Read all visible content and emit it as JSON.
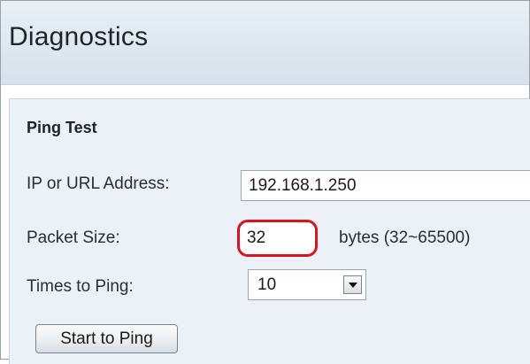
{
  "page": {
    "title": "Diagnostics"
  },
  "ping_test": {
    "section_title": "Ping Test",
    "ip_label": "IP or URL Address:",
    "ip_value": "192.168.1.250",
    "packet_size_label": "Packet Size:",
    "packet_size_value": "32",
    "packet_size_unit": "bytes (32~65500)",
    "times_label": "Times to Ping:",
    "times_value": "10",
    "start_button": "Start to Ping"
  },
  "highlight": {
    "color": "#d9141c",
    "target": "packet-size-input"
  },
  "icons": {
    "dropdown": "chevron-down-icon"
  }
}
